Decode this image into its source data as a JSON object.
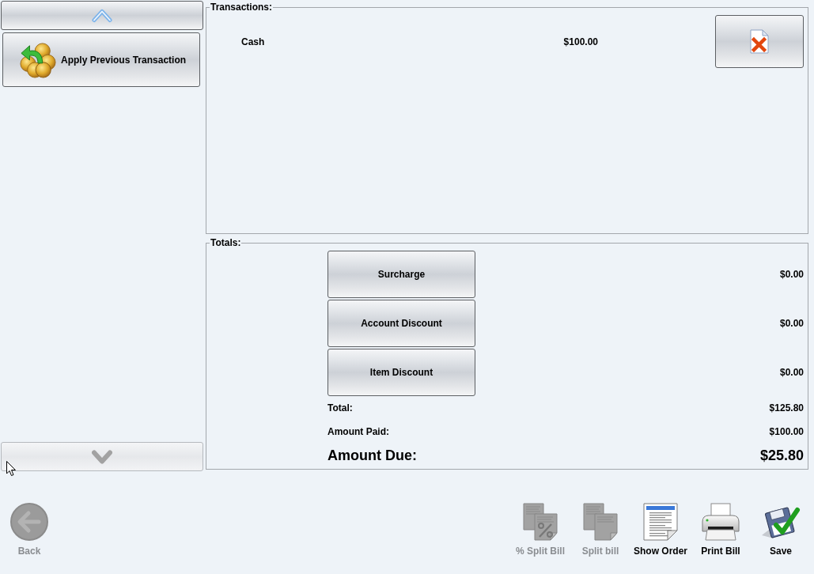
{
  "sidebar": {
    "scroll_up": {
      "disabled": false
    },
    "items": [
      {
        "label": "Apply Previous Transaction"
      }
    ],
    "scroll_down": {
      "disabled": true
    }
  },
  "transactions": {
    "title": "Transactions:",
    "rows": [
      {
        "method": "Cash",
        "amount": "$100.00"
      }
    ]
  },
  "totals": {
    "title": "Totals:",
    "adjustments": [
      {
        "label": "Surcharge",
        "amount": "$0.00"
      },
      {
        "label": "Account Discount",
        "amount": "$0.00"
      },
      {
        "label": "Item Discount",
        "amount": "$0.00"
      }
    ],
    "summary": [
      {
        "label": "Total:",
        "amount": "$125.80",
        "kind": "regular"
      },
      {
        "label": "Amount Paid:",
        "amount": "$100.00",
        "kind": "regular"
      },
      {
        "label": "Amount Due:",
        "amount": "$25.80",
        "kind": "emphasis"
      }
    ]
  },
  "toolbar": {
    "back": {
      "label": "Back",
      "disabled": true
    },
    "actions": [
      {
        "label": "% Split Bill",
        "kind": "percent_split",
        "disabled": true
      },
      {
        "label": "Split bill",
        "kind": "split",
        "disabled": true
      },
      {
        "label": "Show Order",
        "kind": "document",
        "disabled": false
      },
      {
        "label": "Print Bill",
        "kind": "printer",
        "disabled": false
      },
      {
        "label": "Save",
        "kind": "save",
        "disabled": false
      }
    ]
  }
}
